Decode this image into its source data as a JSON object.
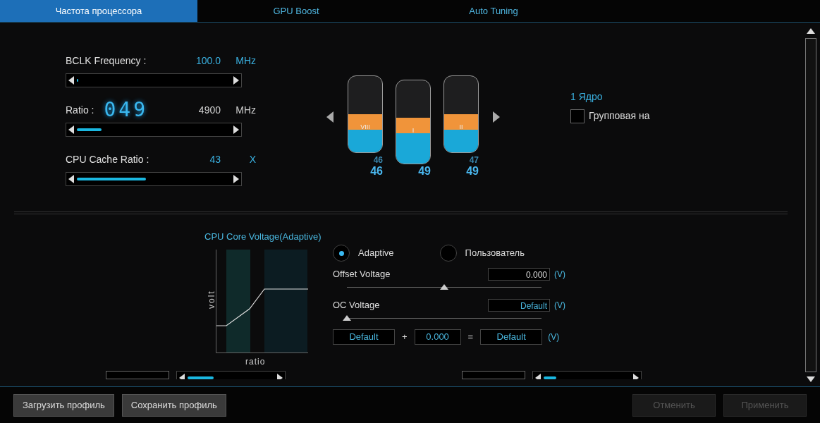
{
  "tabs": [
    {
      "label": "Частота процессора",
      "selected": true
    },
    {
      "label": "GPU Boost",
      "selected": false
    },
    {
      "label": "Auto Tuning",
      "selected": false
    }
  ],
  "frequency": [
    {
      "label": "BCLK Frequency :",
      "value": "100.0",
      "unit": "MHz",
      "level": 0.01,
      "accent": true
    },
    {
      "label": "Ratio :",
      "digits": "049",
      "value": "4900",
      "unit": "MHz",
      "level": 0.16,
      "accent": false
    },
    {
      "label": "CPU Cache Ratio :",
      "value": "43",
      "unit": "X",
      "level": 0.45,
      "accent": true
    }
  ],
  "cores": [
    {
      "label": "VIII",
      "value": "46",
      "small": "46",
      "level": 0.5
    },
    {
      "label": "I",
      "value": "49",
      "level": 0.55
    },
    {
      "label": "II",
      "value": "49",
      "small": "47",
      "level": 0.5
    }
  ],
  "core_panel": {
    "title": "1 Ядро",
    "group_checkbox": {
      "label": "Групповая на",
      "checked": false
    }
  },
  "voltage": {
    "title": "CPU Core Voltage(Adaptive)",
    "ylabel": "volt",
    "xlabel": "ratio",
    "modes": [
      {
        "label": "Adaptive",
        "selected": true
      },
      {
        "label": "Пользователь",
        "selected": false
      }
    ],
    "offset": {
      "label": "Offset Voltage",
      "value": "0.000",
      "unit": "(V)",
      "level": 0.5
    },
    "oc": {
      "label": "OC Voltage",
      "value": "Default",
      "unit": "(V)",
      "level": 0.0
    },
    "sum": {
      "a": "Default",
      "plus": "+",
      "b": "0.000",
      "equals": "=",
      "result": "Default",
      "unit": "(V)"
    }
  },
  "partial_sliders": [
    {
      "level": 0.3
    },
    {
      "level": 0.15
    }
  ],
  "buttons": [
    {
      "label": "Загрузить профиль",
      "disabled": false
    },
    {
      "label": "Сохранить профиль",
      "disabled": false
    },
    {
      "label": "Отменить",
      "disabled": true
    },
    {
      "label": "Применить",
      "disabled": true
    }
  ]
}
